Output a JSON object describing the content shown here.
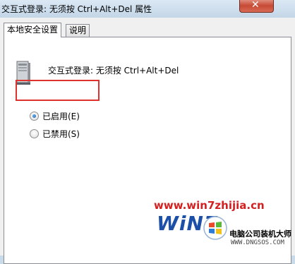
{
  "window": {
    "title": "交互式登录: 无须按 Ctrl+Alt+Del 属性",
    "close_glyph": "✕"
  },
  "tabs": [
    {
      "label": "本地安全设置",
      "active": true
    },
    {
      "label": "说明",
      "active": false
    }
  ],
  "policy": {
    "description": "交互式登录: 无须按 Ctrl+Alt+Del",
    "icon": "computer-icon"
  },
  "options": [
    {
      "label": "已启用(E)",
      "selected": true
    },
    {
      "label": "已禁用(S)",
      "selected": false
    }
  ],
  "watermark": {
    "url": "www.win7zhijia.cn",
    "logo_text": "WiN7",
    "shop_name": "电脑公司装机大师",
    "shop_url": "WWW.DNGSOS.COM"
  },
  "colors": {
    "highlight": "#e0322c",
    "watermark_red": "#d42020",
    "logo_blue": "#1c4fa8"
  }
}
